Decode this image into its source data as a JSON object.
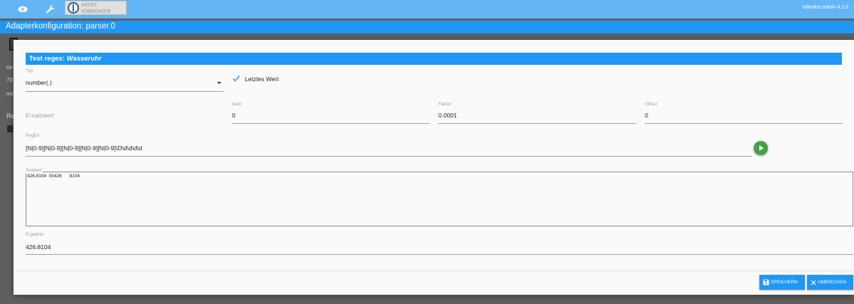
{
  "topbar": {
    "host_button_label": "HOST IOBROKER",
    "version": "ioBroker.admin 4.1.6",
    "icons": [
      "eye-icon",
      "wrench-icon",
      "iobroker-logo-icon"
    ]
  },
  "config": {
    "title": "Adapterkonfiguration: parser.0"
  },
  "background": {
    "text_1": "De",
    "text_2": "70",
    "text_3": "ms",
    "text_4": "Re"
  },
  "dialog": {
    "title_prefix": "Test regex:",
    "title_name": "Wasseruhr",
    "typ": {
      "label": "Typ",
      "value": "number(.)"
    },
    "letztes_wert": {
      "label": "Letztes Wert",
      "checked": true
    },
    "ersatzwert": {
      "placeholder": "Ersatzwert"
    },
    "num": {
      "label": "Num",
      "value": "0"
    },
    "faktor": {
      "label": "Faktor",
      "value": "0.0001"
    },
    "offset": {
      "label": "Offset",
      "value": "0"
    },
    "regex": {
      "label": "RegEx",
      "value": "[N|0-9][N|0-9][N|0-9][N|0-9][N|0-9]\\D\\d\\d\\d\\d"
    },
    "testtext": {
      "label": "Testtext",
      "value": "426.8104  00426      8104"
    },
    "ergebnis": {
      "label": "Ergebnis",
      "value": "426.8104"
    },
    "save_label": "SPEICHERN",
    "cancel_label": "ABBRECHEN"
  },
  "colors": {
    "topbar": "#64b5f6",
    "primary": "#2196f3",
    "run_button": "#43a047"
  }
}
